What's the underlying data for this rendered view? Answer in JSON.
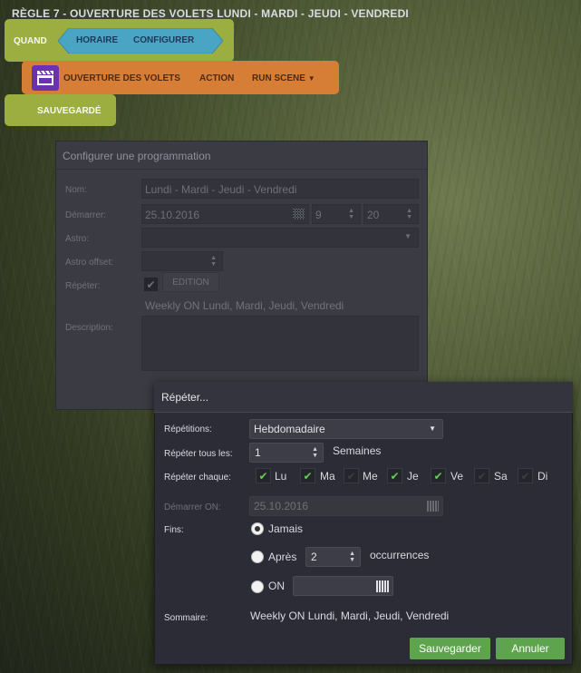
{
  "rule": {
    "title": "RÈGLE 7 - OUVERTURE DES VOLETS LUNDI - MARDI - JEUDI - VENDREDI",
    "when_label": "QUAND",
    "trigger_label": "HORAIRE",
    "configure_label": "CONFIGURER",
    "action_name": "OUVERTURE DES VOLETS",
    "action_label": "ACTION",
    "run_scene_label": "RUN SCENE",
    "saved_label": "SAUVEGARDÉ",
    "colors": {
      "when": "#9cae3f",
      "trigger": "#4aa5c4",
      "action": "#d77e36",
      "scene_icon": "#6a32ae"
    }
  },
  "config_dialog": {
    "title": "Configurer une programmation",
    "name_label": "Nom:",
    "name_value": "Lundi - Mardi - Jeudi - Vendredi",
    "start_label": "Démarrer:",
    "start_date": "25.10.2016",
    "start_hour": "9",
    "start_minute": "20",
    "astro_label": "Astro:",
    "astro_offset_label": "Astro offset:",
    "repeat_label": "Répéter:",
    "edit_button": "EDITION",
    "summary": "Weekly ON Lundi, Mardi, Jeudi, Vendredi",
    "description_label": "Description:"
  },
  "repeat_dialog": {
    "title": "Répéter...",
    "repetitions_label": "Répétitions:",
    "repetitions_value": "Hebdomadaire",
    "every_label": "Répéter tous les:",
    "every_value": "1",
    "every_unit": "Semaines",
    "each_label": "Répéter chaque:",
    "days": [
      {
        "label": "Lu",
        "checked": true
      },
      {
        "label": "Ma",
        "checked": true
      },
      {
        "label": "Me",
        "checked": false
      },
      {
        "label": "Je",
        "checked": true
      },
      {
        "label": "Ve",
        "checked": true
      },
      {
        "label": "Sa",
        "checked": false
      },
      {
        "label": "Di",
        "checked": false
      }
    ],
    "start_on_label": "Démarrer ON:",
    "start_on_value": "25.10.2016",
    "ends_label": "Fins:",
    "ends_options": {
      "never": "Jamais",
      "after": "Après",
      "on": "ON"
    },
    "ends_selected": "never",
    "after_count": "2",
    "occurrences_label": "occurrences",
    "summary_label": "Sommaire:",
    "summary_value": "Weekly ON Lundi, Mardi, Jeudi, Vendredi",
    "save_button": "Sauvegarder",
    "cancel_button": "Annuler"
  }
}
